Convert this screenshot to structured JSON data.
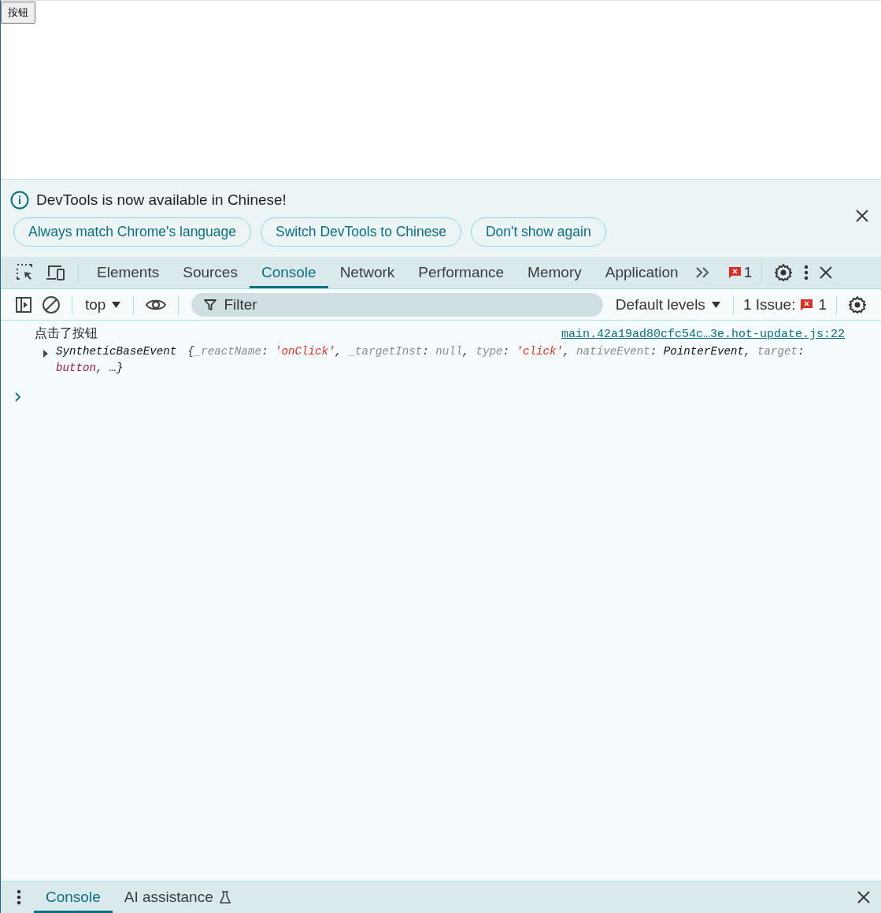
{
  "page": {
    "button": "按钮"
  },
  "infobar": {
    "message": "DevTools is now available in Chinese!",
    "buttons": [
      "Always match Chrome's language",
      "Switch DevTools to Chinese",
      "Don't show again"
    ]
  },
  "main_tabs": [
    {
      "label": "Elements",
      "selected": false
    },
    {
      "label": "Sources",
      "selected": false
    },
    {
      "label": "Console",
      "selected": true
    },
    {
      "label": "Network",
      "selected": false
    },
    {
      "label": "Performance",
      "selected": false
    },
    {
      "label": "Memory",
      "selected": false
    },
    {
      "label": "Application",
      "selected": false
    }
  ],
  "error_count": "1",
  "console_toolbar": {
    "context": "top",
    "filter": {
      "placeholder": "Filter"
    },
    "levels": "Default levels",
    "issues_label": "1 Issue:",
    "issues_count": "1"
  },
  "messages": [
    {
      "text": "点击了按钮",
      "source": "main.42a19ad80cfc54c…3e.hot-update.js:22",
      "object_name": "SyntheticBaseEvent",
      "expanded": false,
      "lines": [
        [
          {
            "kind": "punct",
            "text": "{"
          },
          {
            "kind": "key",
            "text": "_reactName"
          },
          {
            "kind": "punct",
            "text": ": "
          },
          {
            "kind": "string",
            "text": "'onClick'"
          },
          {
            "kind": "punct",
            "text": ", "
          },
          {
            "kind": "key",
            "text": "_targetInst"
          },
          {
            "kind": "punct",
            "text": ": "
          },
          {
            "kind": "null",
            "text": "null"
          },
          {
            "kind": "punct",
            "text": ", "
          },
          {
            "kind": "key",
            "text": "type"
          },
          {
            "kind": "punct",
            "text": ": "
          },
          {
            "kind": "string",
            "text": "'click'"
          },
          {
            "kind": "punct",
            "text": ", "
          },
          {
            "kind": "key",
            "text": "nativeEvent"
          },
          {
            "kind": "punct",
            "text": ": "
          },
          {
            "kind": "plain",
            "text": "PointerEvent"
          },
          {
            "kind": "punct",
            "text": ", "
          },
          {
            "kind": "key",
            "text": "target"
          },
          {
            "kind": "punct",
            "text": ":"
          }
        ],
        [
          {
            "kind": "node",
            "text": "button"
          },
          {
            "kind": "punct",
            "text": ", "
          },
          {
            "kind": "plain",
            "text": "…}"
          }
        ]
      ]
    }
  ],
  "drawer_tabs": [
    {
      "label": "Console",
      "selected": true,
      "kind": "plain"
    },
    {
      "label": "AI assistance",
      "selected": false,
      "kind": "experimental"
    }
  ]
}
